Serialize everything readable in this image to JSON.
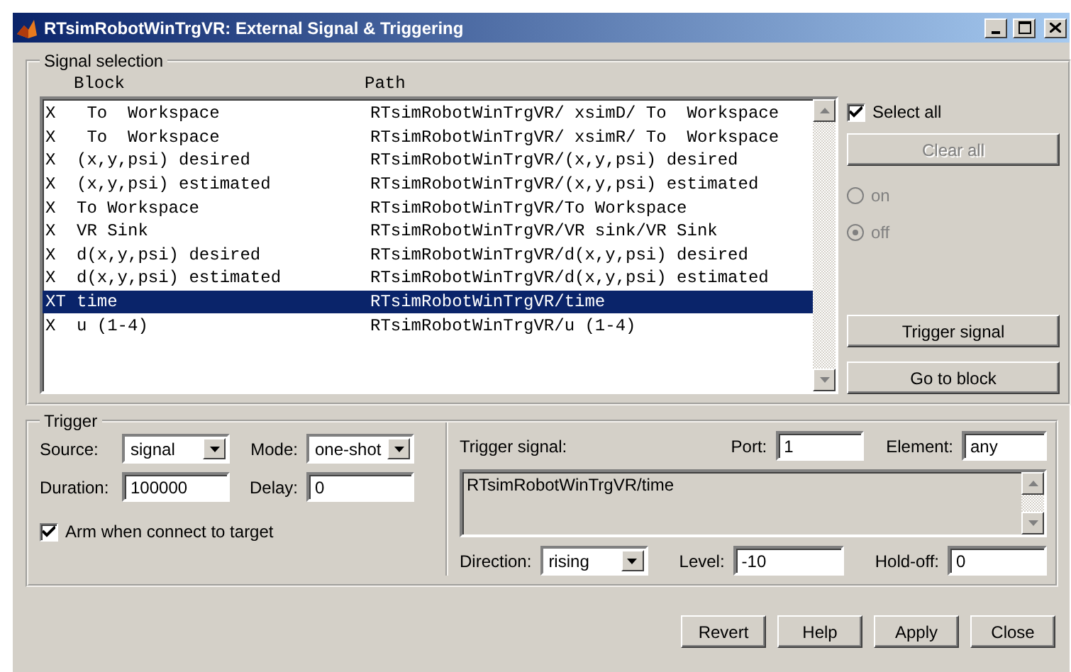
{
  "window": {
    "title": "RTsimRobotWinTrgVR: External Signal & Triggering"
  },
  "signal_selection": {
    "title": "Signal selection",
    "columns": [
      "Block",
      "Path"
    ],
    "rows": [
      {
        "marker": "X",
        "block": " To  Workspace",
        "path": "RTsimRobotWinTrgVR/ xsimD/ To  Workspace",
        "selected": false
      },
      {
        "marker": "X",
        "block": " To  Workspace",
        "path": "RTsimRobotWinTrgVR/ xsimR/ To  Workspace",
        "selected": false
      },
      {
        "marker": "X",
        "block": "(x,y,psi) desired",
        "path": "RTsimRobotWinTrgVR/(x,y,psi) desired",
        "selected": false
      },
      {
        "marker": "X",
        "block": "(x,y,psi) estimated",
        "path": "RTsimRobotWinTrgVR/(x,y,psi) estimated",
        "selected": false
      },
      {
        "marker": "X",
        "block": "To Workspace",
        "path": "RTsimRobotWinTrgVR/To Workspace",
        "selected": false
      },
      {
        "marker": "X",
        "block": "VR Sink",
        "path": "RTsimRobotWinTrgVR/VR sink/VR Sink",
        "selected": false
      },
      {
        "marker": "X",
        "block": "d(x,y,psi) desired",
        "path": "RTsimRobotWinTrgVR/d(x,y,psi) desired",
        "selected": false
      },
      {
        "marker": "X",
        "block": "d(x,y,psi) estimated",
        "path": "RTsimRobotWinTrgVR/d(x,y,psi) estimated",
        "selected": false
      },
      {
        "marker": "XT",
        "block": "time",
        "path": "RTsimRobotWinTrgVR/time",
        "selected": true
      },
      {
        "marker": "X",
        "block": "u (1-4)",
        "path": "RTsimRobotWinTrgVR/u (1-4)",
        "selected": false
      }
    ],
    "select_all": {
      "label": "Select all",
      "checked": true
    },
    "clear_all": {
      "label": "Clear all",
      "disabled": true
    },
    "radios": [
      {
        "label": "on",
        "selected": false,
        "disabled": true
      },
      {
        "label": "off",
        "selected": true,
        "disabled": true
      }
    ],
    "buttons": [
      "Trigger signal",
      "Go to block"
    ]
  },
  "trigger": {
    "title": "Trigger",
    "source": {
      "label": "Source:",
      "value": "signal"
    },
    "mode": {
      "label": "Mode:",
      "value": "one-shot"
    },
    "duration": {
      "label": "Duration:",
      "value": "100000"
    },
    "delay": {
      "label": "Delay:",
      "value": "0"
    },
    "arm": {
      "label": "Arm when connect to target",
      "checked": true
    },
    "trigger_signal": {
      "label": "Trigger signal:",
      "value": "RTsimRobotWinTrgVR/time"
    },
    "port": {
      "label": "Port:",
      "value": "1"
    },
    "element": {
      "label": "Element:",
      "value": "any"
    },
    "direction": {
      "label": "Direction:",
      "value": "rising"
    },
    "level_field": {
      "label": "Level:",
      "value": "-10"
    },
    "hold_off": {
      "label": "Hold-off:",
      "value": "0"
    }
  },
  "buttons": [
    "Revert",
    "Help",
    "Apply",
    "Close"
  ]
}
